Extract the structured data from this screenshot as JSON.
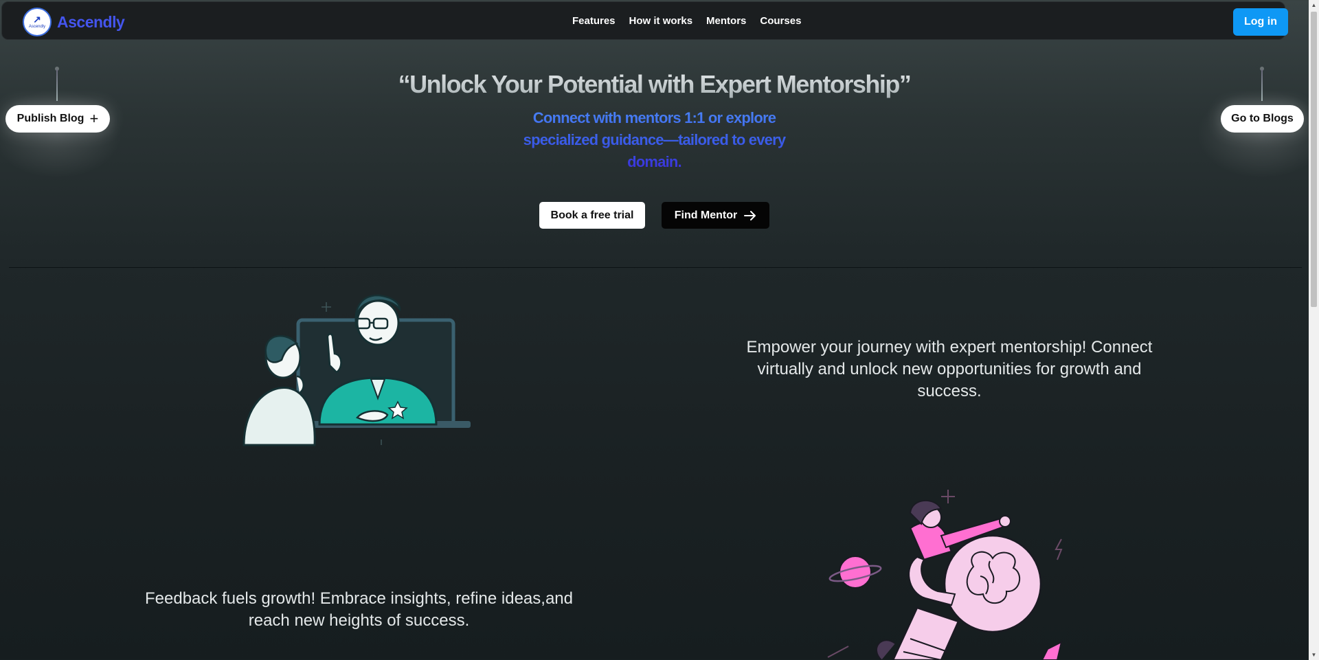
{
  "brand": {
    "name": "Ascendly",
    "logo_text": "Ascendly"
  },
  "nav": {
    "links": [
      "Features",
      "How it works",
      "Mentors",
      "Courses"
    ],
    "login_label": "Log in"
  },
  "side": {
    "publish_label": "Publish Blog",
    "blogs_label": "Go to Blogs"
  },
  "hero": {
    "title": "“Unlock Your Potential with Expert Mentorship”",
    "subtitle": "Connect with mentors 1:1 or explore specialized guidance—tailored to every domain.",
    "cta_free": "Book a free trial",
    "cta_find": "Find Mentor"
  },
  "sections": {
    "mentorship_text": "Empower your journey with expert mentorship! Connect virtually and unlock new opportunities for growth and success.",
    "feedback_text": "Feedback fuels growth! Embrace insights, refine ideas,and reach new heights of success."
  },
  "colors": {
    "accent": "#0e98f5",
    "brand": "#4455ee",
    "teal": "#1cb5a3",
    "pink": "#ff6fd1"
  },
  "icons": {
    "plus": "plus-icon",
    "arrow": "arrow-right-icon"
  }
}
